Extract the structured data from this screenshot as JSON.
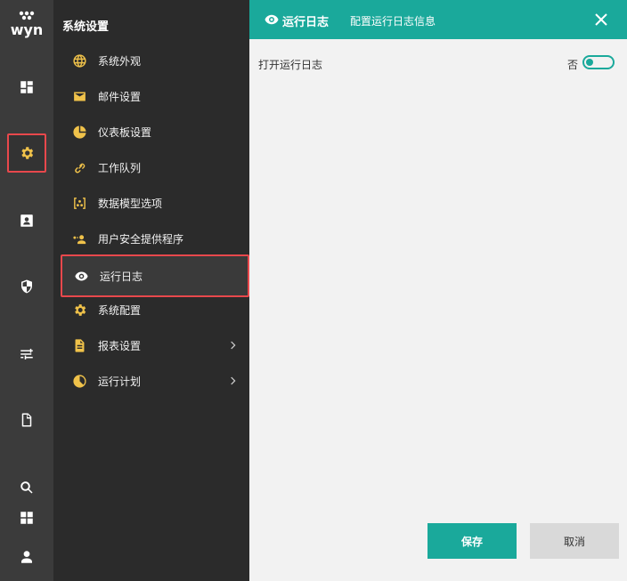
{
  "colors": {
    "accent": "#1aa99b",
    "highlight_border": "#e8484c",
    "icon_yellow": "#f0c24a",
    "rail_bg": "#3b3b3b",
    "menu_bg": "#2b2b2b"
  },
  "rail": {
    "logo_icon": "wyn-logo-icon",
    "items": [
      {
        "icon": "dashboard-icon"
      },
      {
        "icon": "gear-icon",
        "active": true
      },
      {
        "icon": "user-card-icon"
      },
      {
        "icon": "shield-icon"
      },
      {
        "icon": "sliders-icon"
      },
      {
        "icon": "document-icon"
      },
      {
        "icon": "search-icon"
      },
      {
        "icon": "grid-icon"
      },
      {
        "icon": "user-icon"
      }
    ]
  },
  "menu": {
    "title": "系统设置",
    "items": [
      {
        "label": "系统外观",
        "icon": "globe-icon"
      },
      {
        "label": "邮件设置",
        "icon": "mail-icon"
      },
      {
        "label": "仪表板设置",
        "icon": "pie-icon"
      },
      {
        "label": "工作队列",
        "icon": "link-icon"
      },
      {
        "label": "数据模型选项",
        "icon": "data-model-icon"
      },
      {
        "label": "用户安全提供程序",
        "icon": "user-security-icon"
      },
      {
        "label": "运行日志",
        "icon": "eye-icon",
        "active": true
      },
      {
        "label": "系统配置",
        "icon": "gear-icon"
      },
      {
        "label": "报表设置",
        "icon": "report-icon",
        "expandable": true
      },
      {
        "label": "运行计划",
        "icon": "clock-icon",
        "expandable": true
      }
    ]
  },
  "panel": {
    "header": {
      "icon": "eye-icon",
      "title": "运行日志",
      "subtitle": "配置运行日志信息",
      "close_icon": "close-icon"
    },
    "setting": {
      "label": "打开运行日志",
      "toggle_text": "否",
      "toggle_on": false
    },
    "buttons": {
      "save": "保存",
      "cancel": "取消"
    }
  }
}
